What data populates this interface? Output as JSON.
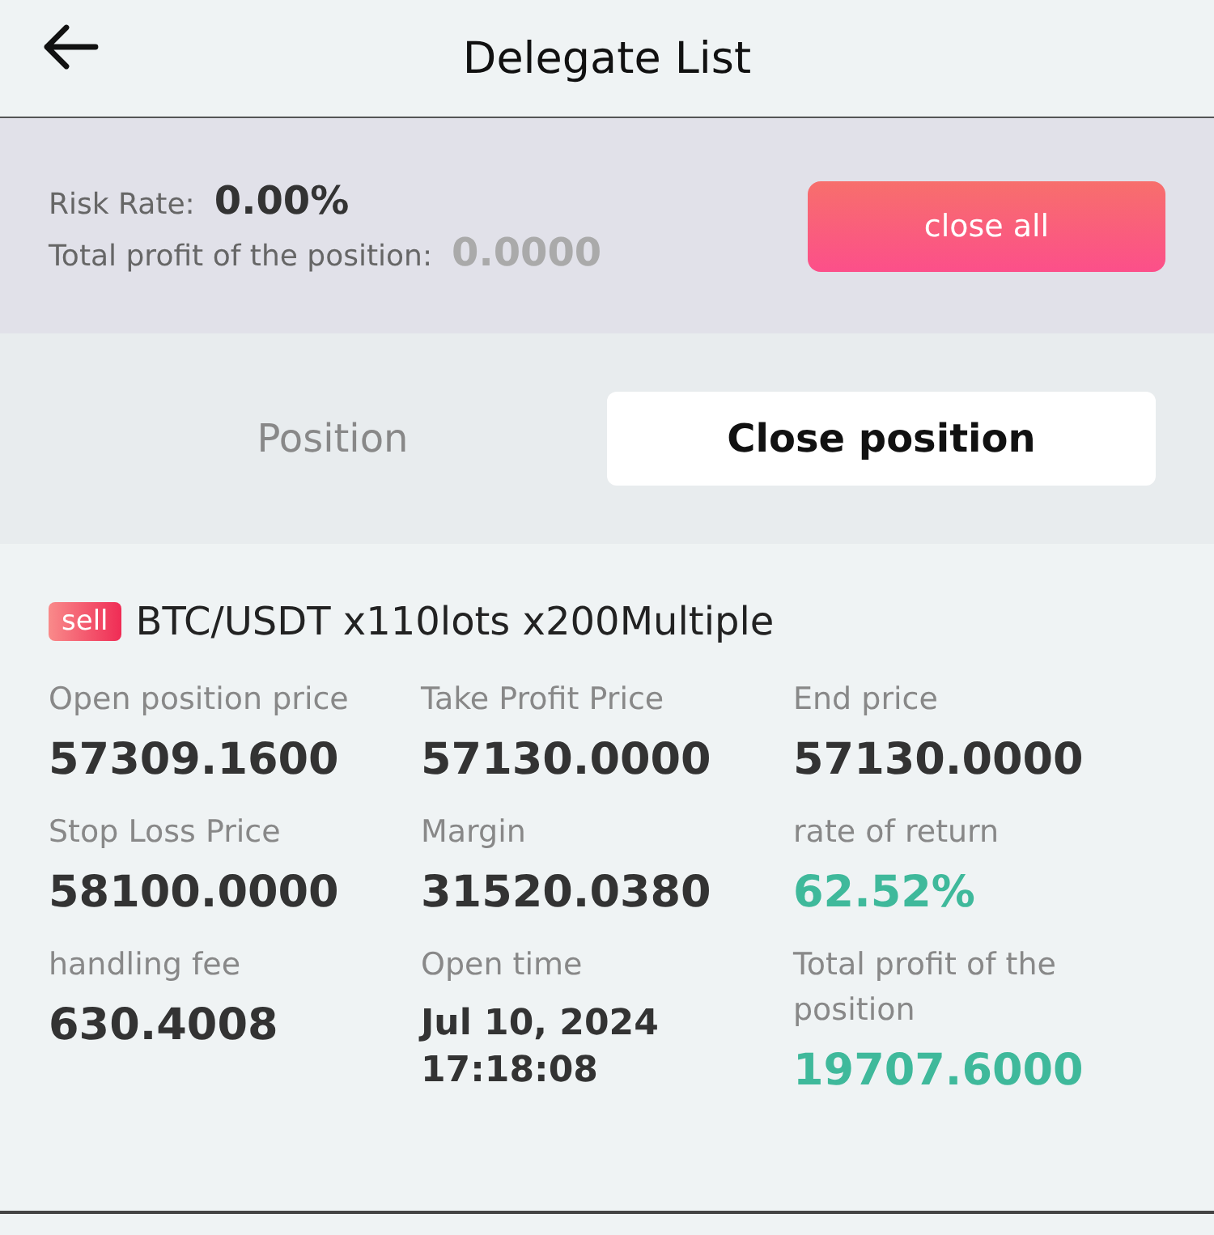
{
  "header": {
    "title": "Delegate List"
  },
  "summary": {
    "risk_label": "Risk Rate:",
    "risk_value": "0.00%",
    "profit_label": "Total profit of the position:",
    "profit_value": "0.0000",
    "button": "close all"
  },
  "tabs": [
    {
      "label": "Position",
      "selected": false
    },
    {
      "label": "Close position",
      "selected": true
    }
  ],
  "order": {
    "side": "sell",
    "title": "BTC/USDT x110lots x200Multiple",
    "fields": [
      {
        "label": "Open position price",
        "value": "57309.1600",
        "color": "#333333"
      },
      {
        "label": "Take Profit Price",
        "value": "57130.0000",
        "color": "#333333"
      },
      {
        "label": "End price",
        "value": "57130.0000",
        "color": "#333333"
      },
      {
        "label": "Stop Loss Price",
        "value": "58100.0000",
        "color": "#333333"
      },
      {
        "label": "Margin",
        "value": "31520.0380",
        "color": "#333333"
      },
      {
        "label": "rate of return",
        "value": "62.52%",
        "color": "#3fb99b"
      },
      {
        "label": "handling fee",
        "value": "630.4008",
        "color": "#333333"
      },
      {
        "label": "Open time",
        "value": "Jul 10, 2024 17:18:08",
        "color": "#333333",
        "kind": "datetime"
      },
      {
        "label": "Total profit of the position",
        "value": "19707.6000",
        "color": "#3fb99b"
      }
    ]
  }
}
